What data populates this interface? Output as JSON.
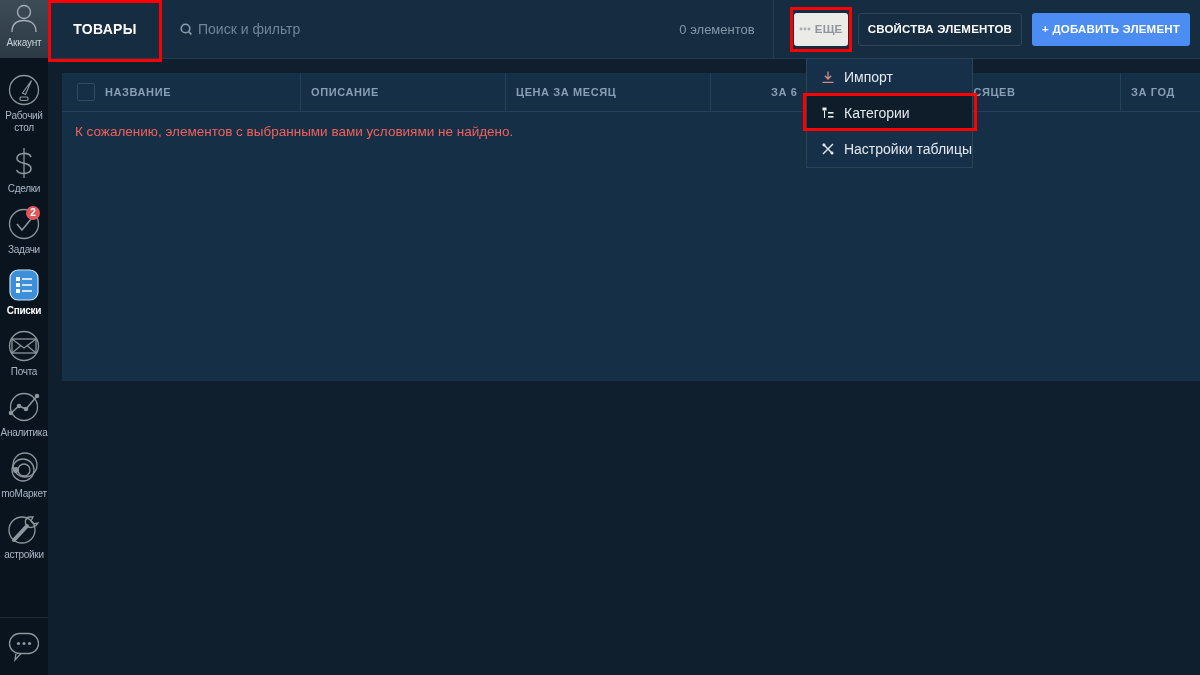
{
  "sidebar": {
    "account": {
      "label": "Аккаунт"
    },
    "items": [
      {
        "kind": "dashboard",
        "label": "Рабочий стол",
        "selected": false
      },
      {
        "kind": "deals",
        "label": "Сделки",
        "selected": false
      },
      {
        "kind": "tasks",
        "label": "Задачи",
        "selected": false,
        "badge": "2"
      },
      {
        "kind": "lists",
        "label": "Списки",
        "selected": true
      },
      {
        "kind": "mail",
        "label": "Почта",
        "selected": false
      },
      {
        "kind": "analytics",
        "label": "Аналитика",
        "selected": false
      },
      {
        "kind": "market",
        "label": "moМаркет",
        "selected": false
      },
      {
        "kind": "settings",
        "label": "астройки",
        "selected": false
      }
    ]
  },
  "header": {
    "title": {
      "text": "ТОВАРЫ",
      "highlighted": true
    },
    "search": {
      "placeholder": "Поиск и фильтр"
    },
    "count": "0 элементов",
    "buttons": [
      {
        "kind": "more",
        "label": "ЕЩЕ",
        "highlighted": true
      },
      {
        "kind": "secondary",
        "label": "СВОЙСТВА ЭЛЕМЕНТОВ",
        "highlighted": false
      },
      {
        "kind": "primary",
        "label": "+ ДОБАВИТЬ ЭЛЕМЕНТ",
        "highlighted": false
      }
    ]
  },
  "table": {
    "select_all": {
      "checked": false
    },
    "columns": [
      {
        "label": "НАЗВАНИЕ"
      },
      {
        "label": "ОПИСАНИЕ"
      },
      {
        "label": "ЦЕНА ЗА МЕСЯЦ"
      },
      {
        "label": "ЗА 6",
        "label_after_menu": "СЯЦЕВ"
      },
      {
        "label": "ЗА ГОД"
      }
    ],
    "empty_message": "К сожалению, элементов с выбранными вами условиями не найдено."
  },
  "dropdown": {
    "items": [
      {
        "kind": "import",
        "label": "Импорт",
        "selected": false,
        "highlighted": false
      },
      {
        "kind": "categories",
        "label": "Категории",
        "selected": true,
        "highlighted": true
      },
      {
        "kind": "table_settings",
        "label": "Настройки таблицы",
        "selected": false,
        "highlighted": false
      }
    ]
  }
}
